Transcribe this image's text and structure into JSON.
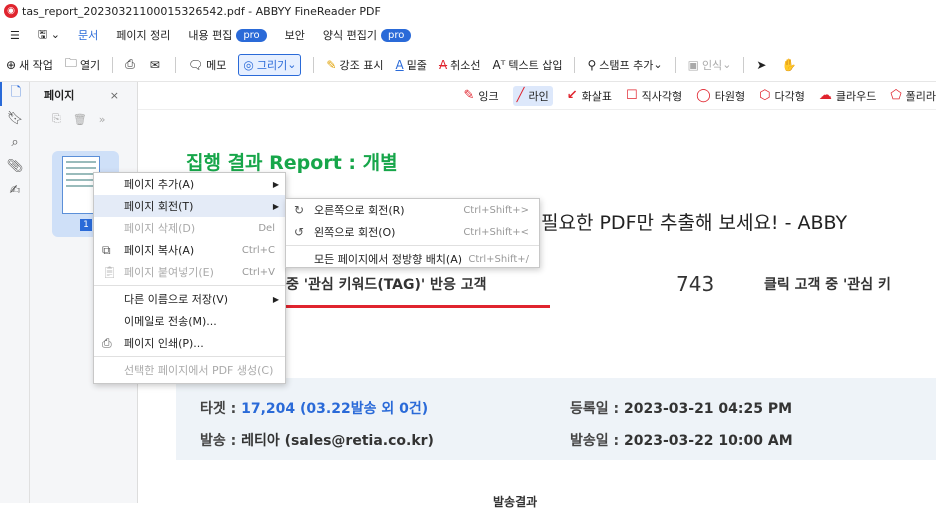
{
  "window": {
    "title": "tas_report_20230321100015326542.pdf - ABBYY FineReader PDF"
  },
  "menubar": {
    "items": [
      {
        "label": "문서",
        "active": true
      },
      {
        "label": "페이지 정리"
      },
      {
        "label": "내용 편집",
        "badge": "pro"
      },
      {
        "label": "보안"
      },
      {
        "label": "양식 편집기",
        "badge": "pro"
      }
    ]
  },
  "toolbar": {
    "new_task": "새 작업",
    "open": "열기",
    "memo": "메모",
    "draw": "그리기",
    "highlight": "강조 표시",
    "underline": "밑줄",
    "strikethrough": "취소선",
    "insert_text": "텍스트 삽입",
    "add_stamp": "스탬프 추가",
    "recognize": "인식"
  },
  "panel": {
    "title": "페이지",
    "close": "×",
    "page_num": "1"
  },
  "annobar": {
    "ink": "잉크",
    "line": "라인",
    "arrow": "화살표",
    "rect": "직사각형",
    "ellipse": "타원형",
    "polygon": "다각형",
    "cloud": "클라우드",
    "poly": "폴리라"
  },
  "doc": {
    "heading": "집행 결과 Report : 개별",
    "banner": "필요한 PDF만 추출해 보세요! - ABBY",
    "tagline": "중 '관심 키워드(TAG)' 반응 고객",
    "count": "743",
    "tagline2": "클릭 고객 중 '관심 키",
    "target_k": "타겟 : ",
    "target_v": "17,204 (03.22발송 외 0건)",
    "reg_k": "등록일 : ",
    "reg_v": "2023-03-21 04:25 PM",
    "sender_k": "발송 : ",
    "sender_v": "레티아 (sales@retia.co.kr)",
    "sent_k": "발송일 : ",
    "sent_v": "2023-03-22 10:00 AM",
    "bottom": "발송결과"
  },
  "context_menu": {
    "add_page": "페이지 추가(A)",
    "rotate_page": "페이지 회전(T)",
    "delete_page": "페이지 삭제(D)",
    "delete_sc": "Del",
    "copy_page": "페이지 복사(A)",
    "copy_sc": "Ctrl+C",
    "paste_page": "페이지 붙여넣기(E)",
    "paste_sc": "Ctrl+V",
    "save_as": "다른 이름으로 저장(V)",
    "email": "이메일로 전송(M)...",
    "print": "페이지 인쇄(P)...",
    "create_pdf": "선택한 페이지에서 PDF 생성(C)"
  },
  "submenu": {
    "rotate_right": "오른쪽으로 회전(R)",
    "rotate_right_sc": "Ctrl+Shift+>",
    "rotate_left": "왼쪽으로 회전(O)",
    "rotate_left_sc": "Ctrl+Shift+<",
    "straighten": "모든 페이지에서 정방향 배치(A)",
    "straighten_sc": "Ctrl+Shift+/"
  }
}
